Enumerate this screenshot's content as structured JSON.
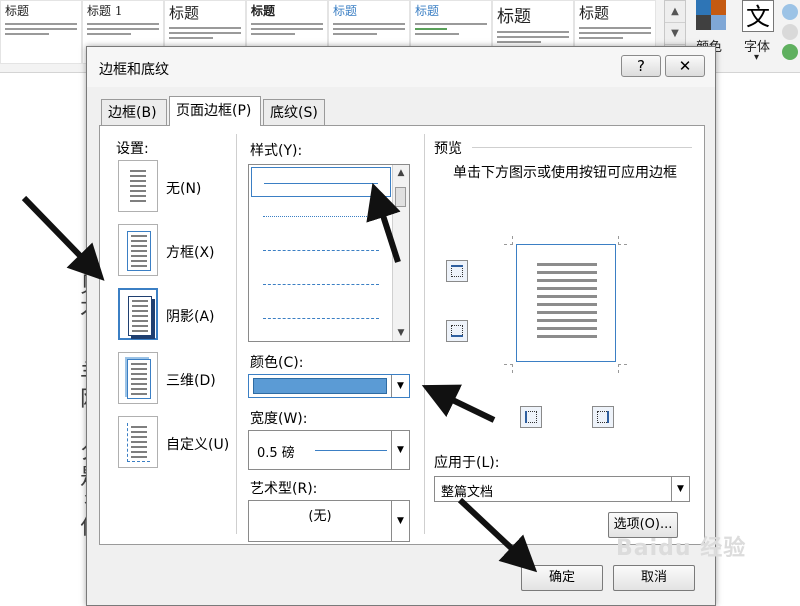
{
  "ribbon": {
    "style_thumbs": [
      "标题",
      "标题 1",
      "标题",
      "标题",
      "标题",
      "标题",
      "标题",
      "标题"
    ],
    "color_label": "颜色",
    "font_label": "字体",
    "font_icon": "文"
  },
  "doc": {
    "fragments": [
      "Ш",
      "贝",
      "才",
      "羊",
      "网",
      "夕",
      "是",
      "彳",
      "仁"
    ]
  },
  "dialog": {
    "title": "边框和底纹",
    "help_label": "?",
    "close_label": "✕",
    "tabs": [
      {
        "label": "边框(B)"
      },
      {
        "label": "页面边框(P)"
      },
      {
        "label": "底纹(S)"
      }
    ],
    "settings": {
      "label": "设置:",
      "items": [
        {
          "label": "无(N)"
        },
        {
          "label": "方框(X)"
        },
        {
          "label": "阴影(A)"
        },
        {
          "label": "三维(D)"
        },
        {
          "label": "自定义(U)"
        }
      ]
    },
    "style": {
      "label": "样式(Y):"
    },
    "color": {
      "label": "颜色(C):",
      "value": "#5b9bd5"
    },
    "width": {
      "label": "宽度(W):",
      "value": "0.5 磅"
    },
    "art": {
      "label": "艺术型(R):",
      "value": "(无)"
    },
    "preview": {
      "label": "预览",
      "hint": "单击下方图示或使用按钮可应用边框"
    },
    "apply_to": {
      "label": "应用于(L):",
      "value": "整篇文档"
    },
    "options_label": "选项(O)...",
    "ok_label": "确定",
    "cancel_label": "取消"
  },
  "watermark": "Baidu 经验"
}
